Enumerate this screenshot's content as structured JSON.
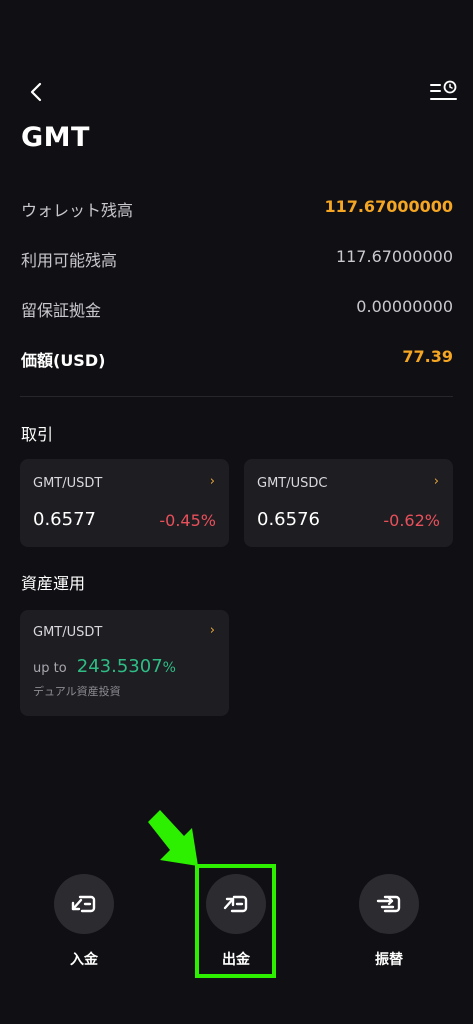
{
  "header": {
    "title": "GMT",
    "back_icon": "chevron-left-icon",
    "history_icon": "list-clock-icon"
  },
  "balances": [
    {
      "label": "ウォレット残高",
      "value": "117.67000000",
      "style": "accent-label"
    },
    {
      "label": "利用可能残高",
      "value": "117.67000000",
      "style": "normal"
    },
    {
      "label": "留保証拠金",
      "value": "0.00000000",
      "style": "normal"
    },
    {
      "label": "価額(USD)",
      "value": "77.39",
      "style": "accent-label"
    }
  ],
  "trade": {
    "section_title": "取引",
    "cards": [
      {
        "pair": "GMT/USDT",
        "price": "0.6577",
        "change": "-0.45%"
      },
      {
        "pair": "GMT/USDC",
        "price": "0.6576",
        "change": "-0.62%"
      }
    ]
  },
  "earn": {
    "section_title": "資産運用",
    "card": {
      "pair": "GMT/USDT",
      "prefix": "up to",
      "apr": "243.5307",
      "apr_unit": "%",
      "product": "デュアル資産投資"
    }
  },
  "actions": [
    {
      "label": "入金",
      "icon": "deposit-icon"
    },
    {
      "label": "出金",
      "icon": "withdraw-icon"
    },
    {
      "label": "振替",
      "icon": "transfer-icon"
    }
  ],
  "colors": {
    "background": "#101014",
    "accent": "#f5a623",
    "negative": "#e8505b",
    "positive": "#2fbd85",
    "highlight": "#2cf000"
  }
}
